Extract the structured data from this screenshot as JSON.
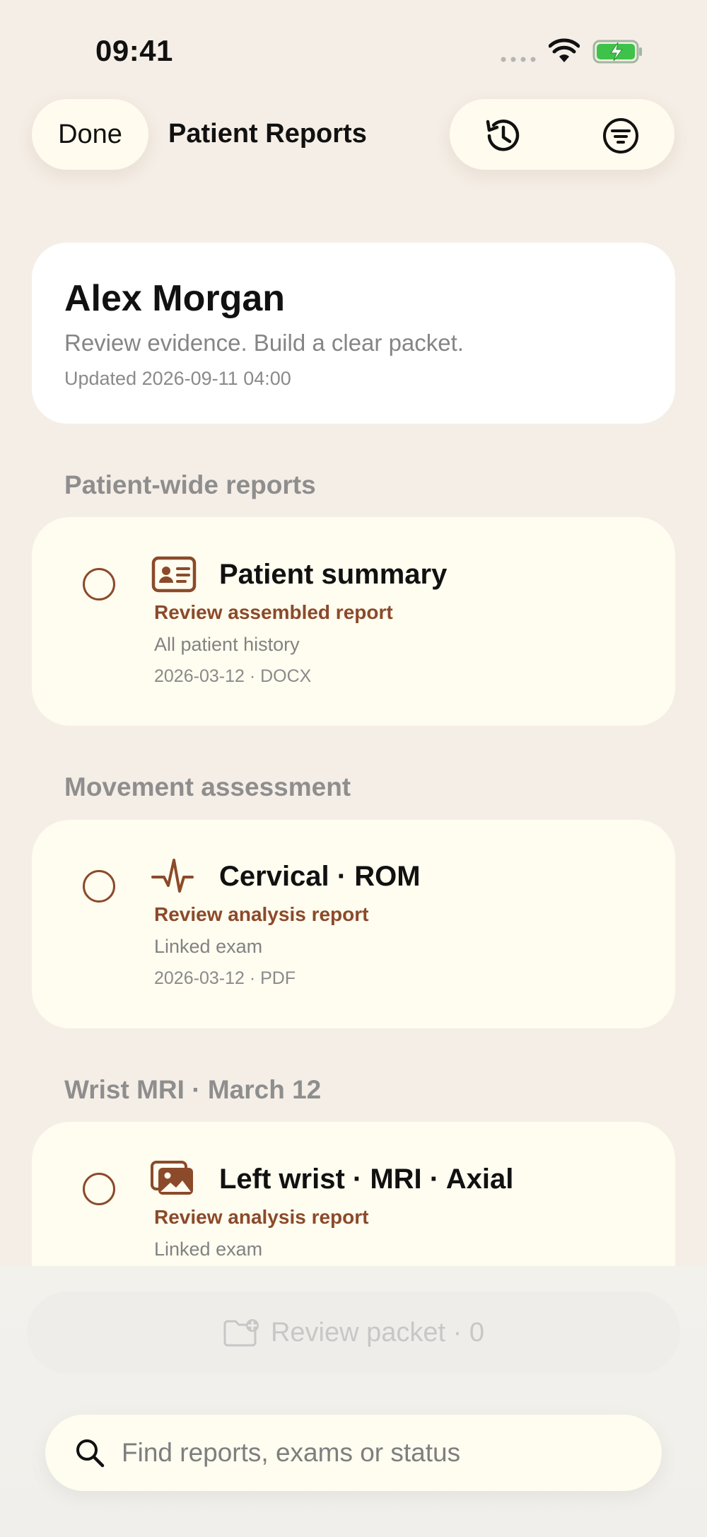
{
  "status_bar": {
    "time": "09:41",
    "icons": [
      "cellular-signal-icon",
      "wifi-icon",
      "battery-charging-icon"
    ]
  },
  "nav": {
    "done_label": "Done",
    "title": "Patient Reports",
    "actions": [
      "history-icon",
      "filter-icon"
    ]
  },
  "patient": {
    "name": "Alex Morgan",
    "tagline": "Review evidence. Build a clear packet.",
    "updated": "Updated 2026-09-11 04:00"
  },
  "sections": [
    {
      "title": "Patient-wide reports",
      "report": {
        "icon": "id-card-icon",
        "title": "Patient summary",
        "action": "Review assembled report",
        "scope": "All patient history",
        "meta": "2026-03-12 · DOCX"
      }
    },
    {
      "title": "Movement assessment",
      "report": {
        "icon": "waveform-icon",
        "title": "Cervical · ROM",
        "action": "Review analysis report",
        "scope": "Linked exam",
        "meta": "2026-03-12 · PDF"
      }
    },
    {
      "title": "Wrist MRI · March 12",
      "report": {
        "icon": "image-stack-icon",
        "title": "Left wrist · MRI · Axial",
        "action": "Review analysis report",
        "scope": "Linked exam",
        "meta": ""
      }
    }
  ],
  "packet": {
    "label": "Review packet · 0"
  },
  "search": {
    "placeholder": "Find reports, exams or status"
  },
  "colors": {
    "accent": "#8b4a2a",
    "background": "#f5eee6",
    "card": "#fffcf0"
  }
}
